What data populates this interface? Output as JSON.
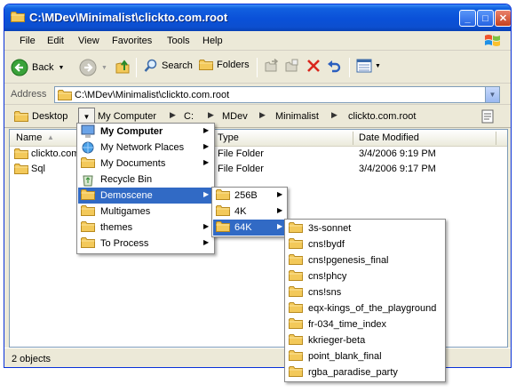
{
  "window": {
    "title": "C:\\MDev\\Minimalist\\clickto.com.root",
    "minimize_label": "_",
    "maximize_label": "□",
    "close_label": "✕"
  },
  "menu": [
    "File",
    "Edit",
    "View",
    "Favorites",
    "Tools",
    "Help"
  ],
  "toolbar": {
    "back_label": "Back",
    "search_label": "Search",
    "folders_label": "Folders"
  },
  "address": {
    "label": "Address",
    "value": "C:\\MDev\\Minimalist\\clickto.com.root"
  },
  "breadcrumb": [
    "Desktop",
    "My Computer",
    "C:",
    "MDev",
    "Minimalist",
    "clickto.com.root"
  ],
  "columns": [
    "Name",
    "Type",
    "Date Modified"
  ],
  "files": [
    {
      "name": "clickto.com",
      "type": "File Folder",
      "date": "3/4/2006 9:19 PM"
    },
    {
      "name": "Sql",
      "type": "File Folder",
      "date": "3/4/2006 9:17 PM"
    }
  ],
  "status": "2 objects",
  "menu1": [
    {
      "label": "My Computer",
      "icon": "computer-icon",
      "bold": true,
      "submenu": true
    },
    {
      "label": "My Network Places",
      "icon": "network-icon",
      "submenu": true
    },
    {
      "label": "My Documents",
      "icon": "documents-icon",
      "submenu": true
    },
    {
      "label": "Recycle Bin",
      "icon": "recycle-bin-icon",
      "submenu": false
    },
    {
      "label": "Demoscene",
      "icon": "folder-icon",
      "submenu": true,
      "selected": true
    },
    {
      "label": "Multigames",
      "icon": "folder-icon",
      "submenu": false
    },
    {
      "label": "themes",
      "icon": "folder-icon",
      "submenu": true
    },
    {
      "label": "To Process",
      "icon": "folder-icon",
      "submenu": true
    }
  ],
  "menu2": [
    {
      "label": "256B",
      "submenu": true
    },
    {
      "label": "4K",
      "submenu": true
    },
    {
      "label": "64K",
      "submenu": true,
      "selected": true
    }
  ],
  "menu3": [
    "3s-sonnet",
    "cns!bydf",
    "cns!pgenesis_final",
    "cns!phcy",
    "cns!sns",
    "eqx-kings_of_the_playground",
    "fr-034_time_index",
    "kkrieger-beta",
    "point_blank_final",
    "rgba_paradise_party"
  ],
  "colors": {
    "titlebar": "#0a50d8",
    "selection": "#316ac5",
    "folder": "#f3c95a",
    "chrome": "#ece9d8"
  }
}
